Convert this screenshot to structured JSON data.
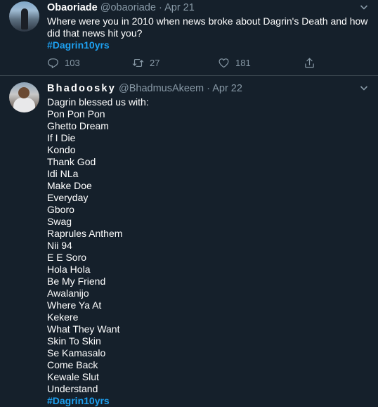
{
  "tweets": [
    {
      "name": "Obaoriade",
      "handle": "@obaoriade",
      "sep": "·",
      "date": "Apr 21",
      "text_lines": [
        "Where were you in 2010 when news broke about Dagrin's Death and how",
        "did that news hit you?"
      ],
      "hashtag": "#Dagrin10yrs",
      "replies": "103",
      "retweets": "27",
      "likes": "181"
    },
    {
      "name": "Bhadoosky",
      "handle": "@BhadmusAkeem",
      "sep": "·",
      "date": "Apr 22",
      "intro": "Dagrin blessed us with:",
      "songs": [
        "Pon Pon Pon",
        "Ghetto Dream",
        "If I Die",
        "Kondo",
        "Thank God",
        "Idi NLa",
        "Make Doe",
        "Everyday",
        "Gboro",
        "Swag",
        "Raprules Anthem",
        "Nii 94",
        "E E Soro",
        "Hola Hola",
        "Be My Friend",
        "Awalanijo",
        "Where Ya At",
        "Kekere",
        "What They Want",
        "Skin To Skin",
        "Se Kamasalo",
        "Come Back",
        "Kewale Slut",
        "Understand"
      ],
      "hashtag": "#Dagrin10yrs"
    }
  ],
  "colors": {
    "background": "#15202b",
    "divider": "#38444d",
    "secondary_text": "#8899a6",
    "accent": "#1da1f2"
  }
}
